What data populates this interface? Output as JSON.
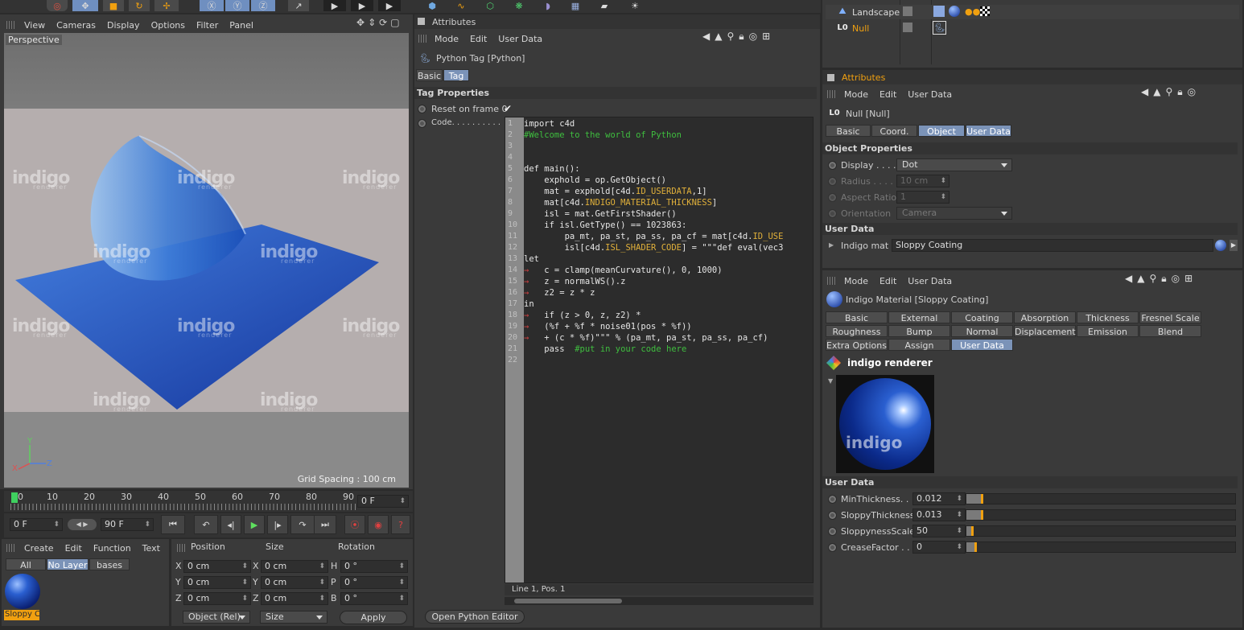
{
  "viewport_menu": [
    "View",
    "Cameras",
    "Display",
    "Options",
    "Filter",
    "Panel"
  ],
  "viewport": {
    "label": "Perspective",
    "grid_spacing": "Grid Spacing : 100 cm",
    "watermark": "indigo",
    "watermark_sub": "renderer",
    "axis_y": "Y",
    "axis_x": "X",
    "axis_z": "Z"
  },
  "timeline": {
    "ticks": [
      "0",
      "10",
      "20",
      "30",
      "40",
      "50",
      "60",
      "70",
      "80",
      "90"
    ],
    "current_frame": "0 F",
    "start": "0 F",
    "end": "90 F"
  },
  "mat_manager": {
    "menu": [
      "Create",
      "Edit",
      "Function",
      "Text"
    ],
    "filters": [
      "All",
      "No Layer",
      "bases"
    ],
    "material_name": "Sloppy C"
  },
  "coords": {
    "headers": [
      "Position",
      "Size",
      "Rotation"
    ],
    "rows": [
      {
        "axis": "X",
        "pos": "0 cm",
        "size_axis": "X",
        "size": "0 cm",
        "rot_axis": "H",
        "rot": "0 °"
      },
      {
        "axis": "Y",
        "pos": "0 cm",
        "size_axis": "Y",
        "size": "0 cm",
        "rot_axis": "P",
        "rot": "0 °"
      },
      {
        "axis": "Z",
        "pos": "0 cm",
        "size_axis": "Z",
        "size": "0 cm",
        "rot_axis": "B",
        "rot": "0 °"
      }
    ],
    "mode": "Object (Rel)",
    "size_mode": "Size",
    "apply": "Apply"
  },
  "attr_center": {
    "title": "Attributes",
    "menu": [
      "Mode",
      "Edit",
      "User Data"
    ],
    "object": "Python Tag [Python]",
    "tabs": [
      "Basic",
      "Tag"
    ],
    "section": "Tag Properties",
    "reset_label": "Reset on frame 0",
    "code_label": "Code. . . . . . . . . .",
    "status": "Line 1, Pos. 1",
    "open_editor": "Open Python Editor",
    "code_lines": [
      "import c4d",
      "#Welcome to the world of Python",
      "",
      "",
      "def main():",
      "    exphold = op.GetObject()",
      "    mat = exphold[c4d.ID_USERDATA,1]",
      "    mat[c4d.INDIGO_MATERIAL_THICKNESS]",
      "    isl = mat.GetFirstShader()",
      "    if isl.GetType() == 1023863:",
      "        pa_mt, pa_st, pa_ss, pa_cf = mat[c4d.ID_USE",
      "        isl[c4d.ISL_SHADER_CODE] = \"\"\"def eval(vec3",
      "let",
      "→   c = clamp(meanCurvature(), 0, 1000)",
      "→   z = normalWS().z",
      "→   z2 = z * z",
      "in",
      "→   if (z > 0, z, z2) *",
      "→   (%f + %f * noise01(pos * %f))",
      "→   + (c * %f)\"\"\" % (pa_mt, pa_st, pa_ss, pa_cf)",
      "    pass  #put in your code here",
      ""
    ]
  },
  "object_manager": {
    "items": [
      {
        "name": "Landscape"
      },
      {
        "name": "Null"
      }
    ]
  },
  "attr_right": {
    "title": "Attributes",
    "menu": [
      "Mode",
      "Edit",
      "User Data"
    ],
    "object": "Null [Null]",
    "tabs": [
      "Basic",
      "Coord.",
      "Object",
      "User Data"
    ],
    "section": "Object Properties",
    "props": [
      {
        "label": "Display . . . .",
        "value": "Dot",
        "enabled": true
      },
      {
        "label": "Radius . . . .",
        "value": "10 cm",
        "enabled": false
      },
      {
        "label": "Aspect Ratio",
        "value": "1",
        "enabled": false
      },
      {
        "label": "Orientation",
        "value": "Camera",
        "enabled": false
      }
    ],
    "user_data_section": "User Data",
    "indigo_label": "Indigo mat",
    "indigo_value": "Sloppy Coating"
  },
  "material_panel": {
    "menu": [
      "Mode",
      "Edit",
      "User Data"
    ],
    "title": "Indigo Material [Sloppy Coating]",
    "tabs_row1": [
      "Basic",
      "External",
      "Coating",
      "Absorption",
      "Thickness",
      "Fresnel Scale"
    ],
    "tabs_row2": [
      "Roughness",
      "Bump",
      "Normal",
      "Displacement",
      "Emission",
      "Blend"
    ],
    "tabs_row3": [
      "Extra Options",
      "Assign",
      "User Data"
    ],
    "brand": "indigo renderer",
    "preview_text": "indigo",
    "user_data_section": "User Data",
    "params": [
      {
        "label": "MinThickness. . .",
        "value": "0.012",
        "fraction": 0.06
      },
      {
        "label": "SloppyThickness",
        "value": "0.013",
        "fraction": 0.06
      },
      {
        "label": "SloppynessScale",
        "value": "50",
        "fraction": 0.024
      },
      {
        "label": "CreaseFactor . . .",
        "value": "0",
        "fraction": 0.035
      }
    ]
  },
  "colors": {
    "accent": "#7b93b8",
    "orange": "#f0a010",
    "material_blue": "#1f4fb8"
  }
}
